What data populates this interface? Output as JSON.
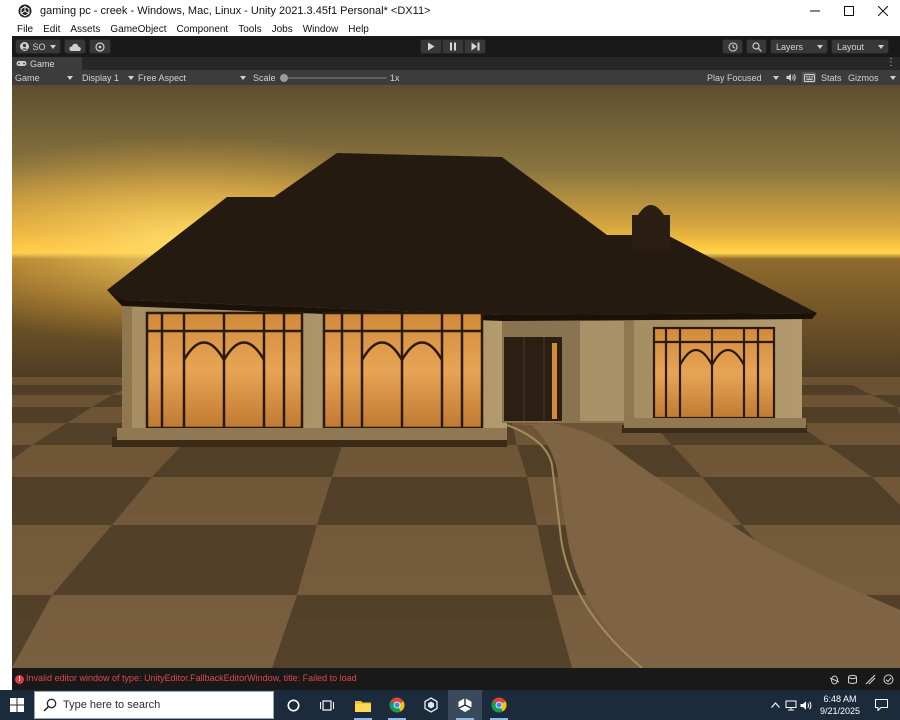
{
  "window": {
    "title": "gaming pc - creek - Windows, Mac, Linux - Unity 2021.3.45f1 Personal* <DX11>",
    "minimize_icon": "minimize-icon",
    "maximize_icon": "maximize-icon",
    "close_icon": "close-icon"
  },
  "menu": [
    "File",
    "Edit",
    "Assets",
    "GameObject",
    "Component",
    "Tools",
    "Jobs",
    "Window",
    "Help"
  ],
  "toolbar": {
    "account_label": "SO",
    "history_icon": "history-icon",
    "search_icon": "search-icon",
    "layers_label": "Layers",
    "layout_label": "Layout"
  },
  "game_tab": {
    "label": "Game"
  },
  "game_toolbar": {
    "view_select": "Game",
    "display_select": "Display 1",
    "aspect_select": "Free Aspect",
    "scale_label": "Scale",
    "scale_value_text": "1x",
    "scale_value": 1,
    "play_mode_select": "Play Focused",
    "stats_label": "Stats",
    "gizmos_label": "Gizmos"
  },
  "status": {
    "error_text": "Invalid editor window of type: UnityEditor.FallbackEditorWindow, title: Failed to load"
  },
  "taskbar": {
    "search_placeholder": "Type here to search",
    "time": "6:48 AM",
    "date": "9/21/2025",
    "apps": [
      "cortana-icon",
      "task-view-icon",
      "file-explorer-icon",
      "chrome-icon",
      "unity-hub-icon",
      "unity-editor-icon",
      "chrome-icon"
    ]
  },
  "colors": {
    "editor_dark": "#191919",
    "panel": "#3c3c3c",
    "error_red": "#e04848",
    "sky_top": "#5c4e2e",
    "sky_horizon": "#ffd24a",
    "roof": "#241a0f",
    "wall": "#a48c60",
    "taskbar": "#1c2b3c"
  }
}
